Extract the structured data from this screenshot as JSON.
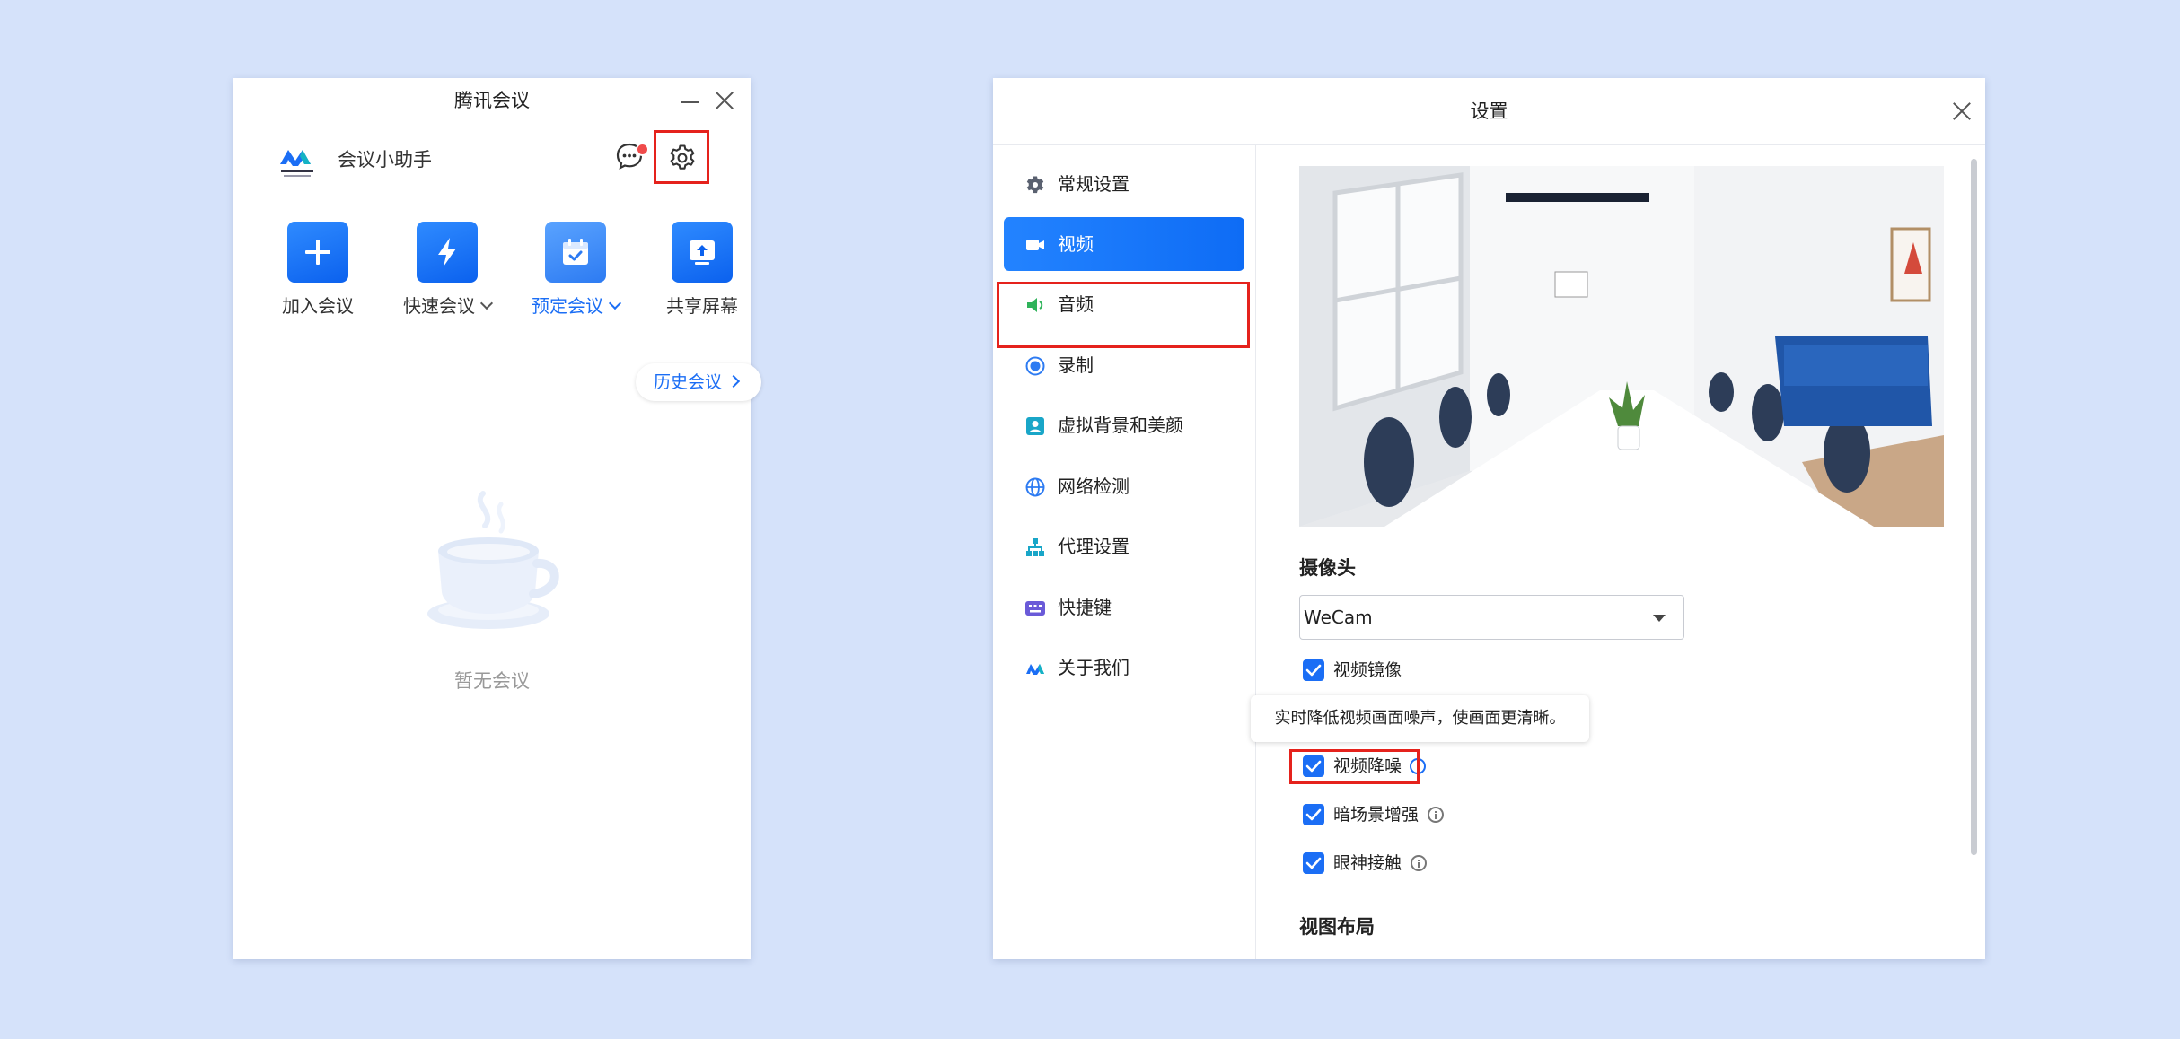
{
  "meeting_window": {
    "title": "腾讯会议",
    "assistant_name": "会议小助手",
    "quick_actions": [
      {
        "label": "加入会议",
        "icon": "plus-icon",
        "has_dropdown": false
      },
      {
        "label": "快速会议",
        "icon": "lightning-icon",
        "has_dropdown": true
      },
      {
        "label": "预定会议",
        "icon": "calendar-check-icon",
        "has_dropdown": true,
        "highlighted": true
      },
      {
        "label": "共享屏幕",
        "icon": "share-screen-icon",
        "has_dropdown": false
      }
    ],
    "history_label": "历史会议",
    "empty_text": "暂无会议"
  },
  "settings_window": {
    "title": "设置",
    "nav_items": [
      {
        "label": "常规设置",
        "icon": "gear-icon"
      },
      {
        "label": "视频",
        "icon": "video-camera-icon",
        "active": true
      },
      {
        "label": "音频",
        "icon": "speaker-icon"
      },
      {
        "label": "录制",
        "icon": "record-icon"
      },
      {
        "label": "虚拟背景和美颜",
        "icon": "portrait-icon"
      },
      {
        "label": "网络检测",
        "icon": "globe-icon"
      },
      {
        "label": "代理设置",
        "icon": "network-tree-icon"
      },
      {
        "label": "快捷键",
        "icon": "keyboard-icon"
      },
      {
        "label": "关于我们",
        "icon": "tencent-meeting-logo-icon"
      }
    ],
    "camera_section_title": "摄像头",
    "camera_value": "WeCam",
    "checkboxes": [
      {
        "label": "视频镜像",
        "checked": true,
        "has_info": false
      },
      {
        "label": "视频降噪",
        "checked": true,
        "has_info": true
      },
      {
        "label": "暗场景增强",
        "checked": true,
        "has_info": true
      },
      {
        "label": "眼神接触",
        "checked": true,
        "has_info": true
      }
    ],
    "tooltip_text": "实时降低视频画面噪声，使画面更清晰。",
    "layout_section_title": "视图布局"
  },
  "colors": {
    "accent": "#1b6ef5",
    "highlight_box": "#e5221c",
    "background": "#d5e2fa"
  }
}
